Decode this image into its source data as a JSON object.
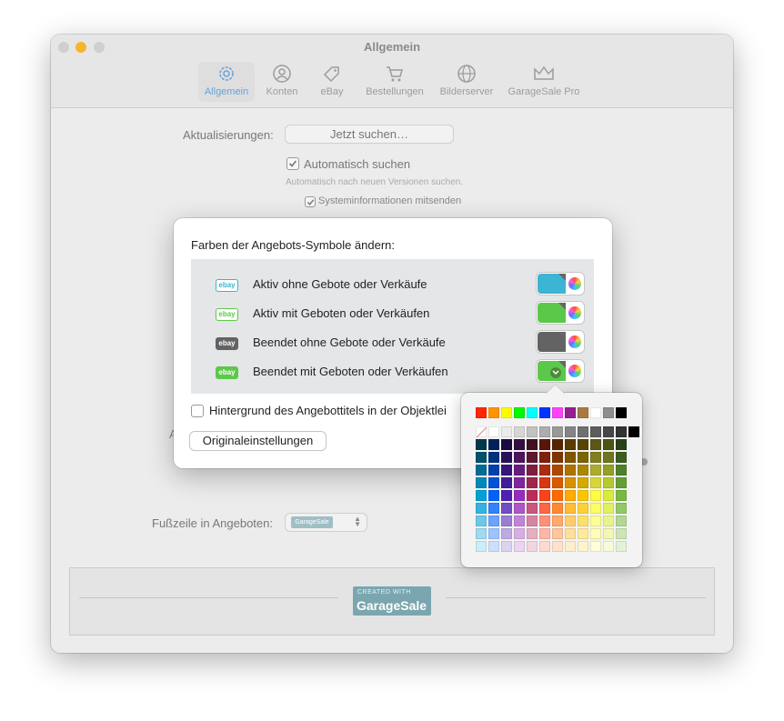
{
  "window": {
    "title": "Allgemein"
  },
  "tabs": [
    {
      "name": "allgemein",
      "label": "Allgemein",
      "icon": "gear-icon",
      "active": true
    },
    {
      "name": "konten",
      "label": "Konten",
      "icon": "person-icon",
      "active": false
    },
    {
      "name": "ebay",
      "label": "eBay",
      "icon": "tag-icon",
      "active": false
    },
    {
      "name": "bestellungen",
      "label": "Bestellungen",
      "icon": "cart-icon",
      "active": false
    },
    {
      "name": "bilderserver",
      "label": "Bilderserver",
      "icon": "globe-icon",
      "active": false
    },
    {
      "name": "garagesale-pro",
      "label": "GarageSale Pro",
      "icon": "crown-icon",
      "active": false
    }
  ],
  "settings": {
    "updates_label": "Aktualisierungen:",
    "check_now_button": "Jetzt suchen…",
    "auto_check_label": "Automatisch suchen",
    "auto_check_hint": "Automatisch nach neuen Versionen suchen.",
    "send_sysinfo_label": "Systeminformationen mitsenden",
    "footer_label": "Fußzeile in Angeboten:",
    "footer_logo_top": "CREATED WITH",
    "footer_logo_text": "GarageSale",
    "partial_label": "A"
  },
  "bottom_logo": {
    "top": "CREATED WITH",
    "text": "GarageSale"
  },
  "sheet": {
    "title": "Farben der Angebots-Symbole ändern:",
    "rows": [
      {
        "badge": "ebay",
        "label": "Aktiv ohne Gebote oder Verkäufe",
        "color": "#3cb4d3",
        "badge_style": "outline",
        "badge_color": "#3cb4d3"
      },
      {
        "badge": "ebay",
        "label": "Aktiv mit Geboten oder Verkäufen",
        "color": "#5cc84a",
        "badge_style": "outline",
        "badge_color": "#5cc84a"
      },
      {
        "badge": "ebay",
        "label": "Beendet ohne Gebote oder Verkäufe",
        "color": "#636363",
        "badge_style": "filled",
        "badge_color": "#636363"
      },
      {
        "badge": "ebay",
        "label": "Beendet mit Geboten oder Verkäufen",
        "color": "#5cc84a",
        "badge_style": "filled",
        "badge_color": "#5cc84a"
      }
    ],
    "background_checkbox_label": "Hintergrund des Angebottitels in der Objektlei",
    "reset_button": "Originaleinstellungen"
  },
  "palette": {
    "top_row": [
      "#ff2600",
      "#ff9300",
      "#fffb00",
      "#00f900",
      "#00fdff",
      "#0433ff",
      "#ff40ff",
      "#942192",
      "#aa7942",
      "#ffffff",
      "#8e8e8e",
      "#000000"
    ],
    "grays": [
      "none",
      "#ffffff",
      "#ebebeb",
      "#d6d6d6",
      "#c2c2c2",
      "#adadad",
      "#999999",
      "#858585",
      "#707070",
      "#5c5c5c",
      "#474747",
      "#333333",
      "#000000"
    ],
    "hues": [
      "#00a1d8",
      "#0061fd",
      "#4d22b2",
      "#982abc",
      "#b92d5d",
      "#ff4015",
      "#ff6a00",
      "#ffab01",
      "#fcc700",
      "#fefb41",
      "#d9ec37",
      "#76bb40"
    ],
    "lightness": [
      -0.65,
      -0.5,
      -0.32,
      -0.15,
      0,
      0.2,
      0.42,
      0.62,
      0.8
    ]
  }
}
